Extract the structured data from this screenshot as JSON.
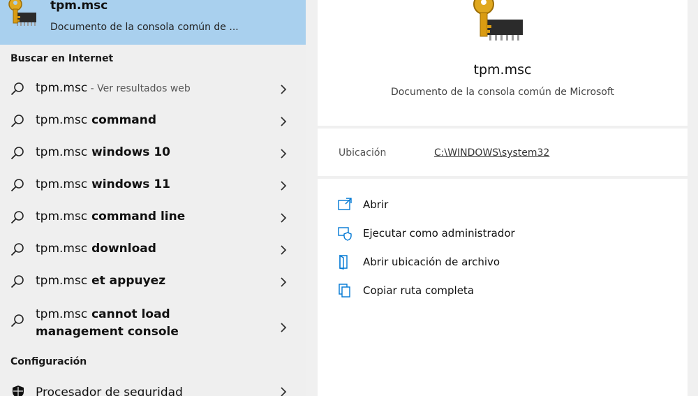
{
  "best_match": {
    "title": "tpm.msc",
    "subtitle": "Documento de la consola común de ..."
  },
  "web_section": {
    "header": "Buscar en Internet",
    "items": [
      {
        "query": "tpm.msc",
        "suffix": "",
        "hint": " - Ver resultados web"
      },
      {
        "query": "tpm.msc",
        "suffix": " command",
        "hint": ""
      },
      {
        "query": "tpm.msc",
        "suffix": " windows 10",
        "hint": ""
      },
      {
        "query": "tpm.msc",
        "suffix": " windows 11",
        "hint": ""
      },
      {
        "query": "tpm.msc",
        "suffix": " command line",
        "hint": ""
      },
      {
        "query": "tpm.msc",
        "suffix": " download",
        "hint": ""
      },
      {
        "query": "tpm.msc",
        "suffix": " et appuyez",
        "hint": ""
      },
      {
        "query": "tpm.msc",
        "suffix": " cannot load management console",
        "hint": ""
      }
    ]
  },
  "settings_section": {
    "header": "Configuración",
    "item_label": "Procesador de seguridad",
    "item_icon": "shield-icon"
  },
  "details": {
    "title": "tpm.msc",
    "description": "Documento de la consola común de Microsoft",
    "location_label": "Ubicación",
    "location_value": "C:\\WINDOWS\\system32",
    "actions": [
      {
        "label": "Abrir",
        "icon": "open-icon"
      },
      {
        "label": "Ejecutar como administrador",
        "icon": "run-as-admin-icon"
      },
      {
        "label": "Abrir ubicación de archivo",
        "icon": "file-location-icon"
      },
      {
        "label": "Copiar ruta completa",
        "icon": "copy-path-icon"
      }
    ]
  },
  "colors": {
    "selection": "#a9d0ee",
    "pane_bg": "#efefef",
    "accent_icon": "#0078d4"
  }
}
